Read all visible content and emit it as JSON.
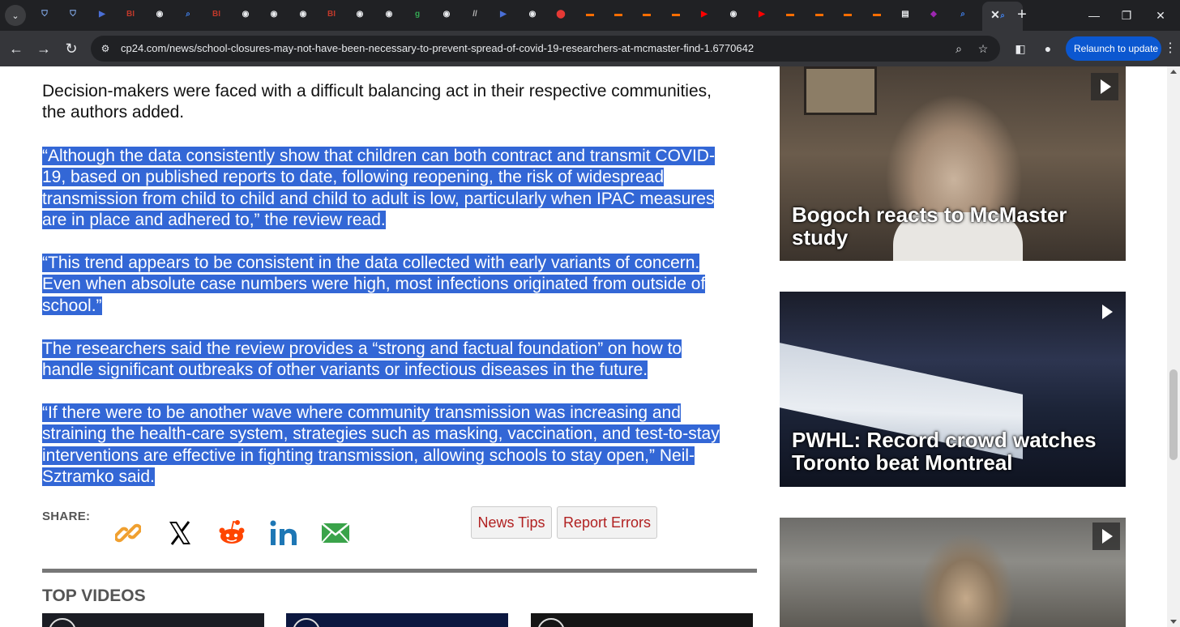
{
  "browser": {
    "url": "cp24.com/news/school-closures-may-not-have-been-necessary-to-prevent-spread-of-covid-19-researchers-at-mcmaster-find-1.6770642",
    "relaunch_label": "Relaunch to update",
    "tabs": [
      {
        "icon": "shield-icon",
        "glyph": "⛉",
        "color": "#8ab4f8"
      },
      {
        "icon": "shield-icon",
        "glyph": "⛉",
        "color": "#8ab4f8"
      },
      {
        "icon": "forward-icon",
        "glyph": "▶",
        "color": "#4a6fd6"
      },
      {
        "icon": "bi-logo-icon",
        "glyph": "BI",
        "color": "#c0392b"
      },
      {
        "icon": "globe-icon",
        "glyph": "◉",
        "color": "#e8eaed"
      },
      {
        "icon": "search-icon",
        "glyph": "⌕",
        "color": "#4285f4"
      },
      {
        "icon": "bi-logo-icon",
        "glyph": "BI",
        "color": "#c0392b"
      },
      {
        "icon": "globe-icon",
        "glyph": "◉",
        "color": "#e8eaed"
      },
      {
        "icon": "globe-icon",
        "glyph": "◉",
        "color": "#e8eaed"
      },
      {
        "icon": "globe-icon",
        "glyph": "◉",
        "color": "#e8eaed"
      },
      {
        "icon": "bi-logo-icon",
        "glyph": "BI",
        "color": "#c0392b"
      },
      {
        "icon": "globe-icon",
        "glyph": "◉",
        "color": "#e8eaed"
      },
      {
        "icon": "globe-icon",
        "glyph": "◉",
        "color": "#e8eaed"
      },
      {
        "icon": "g-logo-icon",
        "glyph": "g",
        "color": "#34a853"
      },
      {
        "icon": "globe-icon",
        "glyph": "◉",
        "color": "#e8eaed"
      },
      {
        "icon": "slash-logo-icon",
        "glyph": "//",
        "color": "#bbbbbb"
      },
      {
        "icon": "forward-icon",
        "glyph": "▶",
        "color": "#4a6fd6"
      },
      {
        "icon": "globe-icon",
        "glyph": "◉",
        "color": "#e8eaed"
      },
      {
        "icon": "pin-icon",
        "glyph": "⬤",
        "color": "#e53935"
      },
      {
        "icon": "bookmark-icon",
        "glyph": "▬",
        "color": "#ff6d00"
      },
      {
        "icon": "bookmark-icon",
        "glyph": "▬",
        "color": "#ff6d00"
      },
      {
        "icon": "bookmark-icon",
        "glyph": "▬",
        "color": "#ff6d00"
      },
      {
        "icon": "bookmark-icon",
        "glyph": "▬",
        "color": "#ff6d00"
      },
      {
        "icon": "youtube-icon",
        "glyph": "▶",
        "color": "#ff0000"
      },
      {
        "icon": "globe-icon",
        "glyph": "◉",
        "color": "#e8eaed"
      },
      {
        "icon": "youtube-icon",
        "glyph": "▶",
        "color": "#ff0000"
      },
      {
        "icon": "bookmark-icon",
        "glyph": "▬",
        "color": "#ff6d00"
      },
      {
        "icon": "bookmark-icon",
        "glyph": "▬",
        "color": "#ff6d00"
      },
      {
        "icon": "bookmark-icon",
        "glyph": "▬",
        "color": "#ff6d00"
      },
      {
        "icon": "bookmark-icon",
        "glyph": "▬",
        "color": "#ff6d00"
      },
      {
        "icon": "tv-icon",
        "glyph": "▤",
        "color": "#e8eaed"
      },
      {
        "icon": "purple-logo-icon",
        "glyph": "◆",
        "color": "#9c27b0"
      },
      {
        "icon": "search-icon",
        "glyph": "⌕",
        "color": "#4285f4"
      }
    ],
    "colors": {
      "chrome_dark": "#202124",
      "chrome_toolbar": "#35363a",
      "relaunch_blue": "#0b57d0",
      "selection": "#3367d6"
    }
  },
  "article": {
    "paragraphs": [
      {
        "selected": false,
        "lines": [
          "Decision-makers were faced with a difficult balancing act in their respective communities,",
          "the authors added."
        ]
      },
      {
        "selected": true,
        "lines": [
          "“Although the data consistently show that children can both contract and transmit COVID-",
          "19, based on published reports to date, following reopening, the risk of widespread",
          "transmission from child to child and child to adult is low, particularly when IPAC measures",
          "are in place and adhered to,” the review read."
        ]
      },
      {
        "selected": true,
        "lines": [
          "“This trend appears to be consistent in the data collected with early variants of concern.",
          "Even when absolute case numbers were high, most infections originated from outside of",
          "school.”"
        ]
      },
      {
        "selected": true,
        "lines": [
          "The researchers said the review provides a “strong and factual foundation” on how to",
          "handle significant outbreaks of other variants or infectious diseases in the future."
        ]
      },
      {
        "selected": true,
        "lines": [
          "“If there were to be another wave where community transmission was increasing and",
          "straining the health-care system, strategies such as masking, vaccination, and test-to-stay",
          "interventions are effective in fighting transmission, allowing schools to stay open,” Neil-",
          "Sztramko said."
        ]
      }
    ],
    "share_label": "SHARE:",
    "share_icons": [
      "link-icon",
      "x-icon",
      "reddit-icon",
      "linkedin-icon",
      "email-icon"
    ],
    "news_tips_label": "News Tips",
    "report_errors_label": "Report Errors",
    "top_videos_label": "TOP VIDEOS"
  },
  "sidebar_videos": [
    {
      "caption": "Bogoch reacts to McMaster study"
    },
    {
      "caption": "PWHL: Record crowd watches Toronto beat Montreal"
    },
    {
      "caption": ""
    }
  ]
}
